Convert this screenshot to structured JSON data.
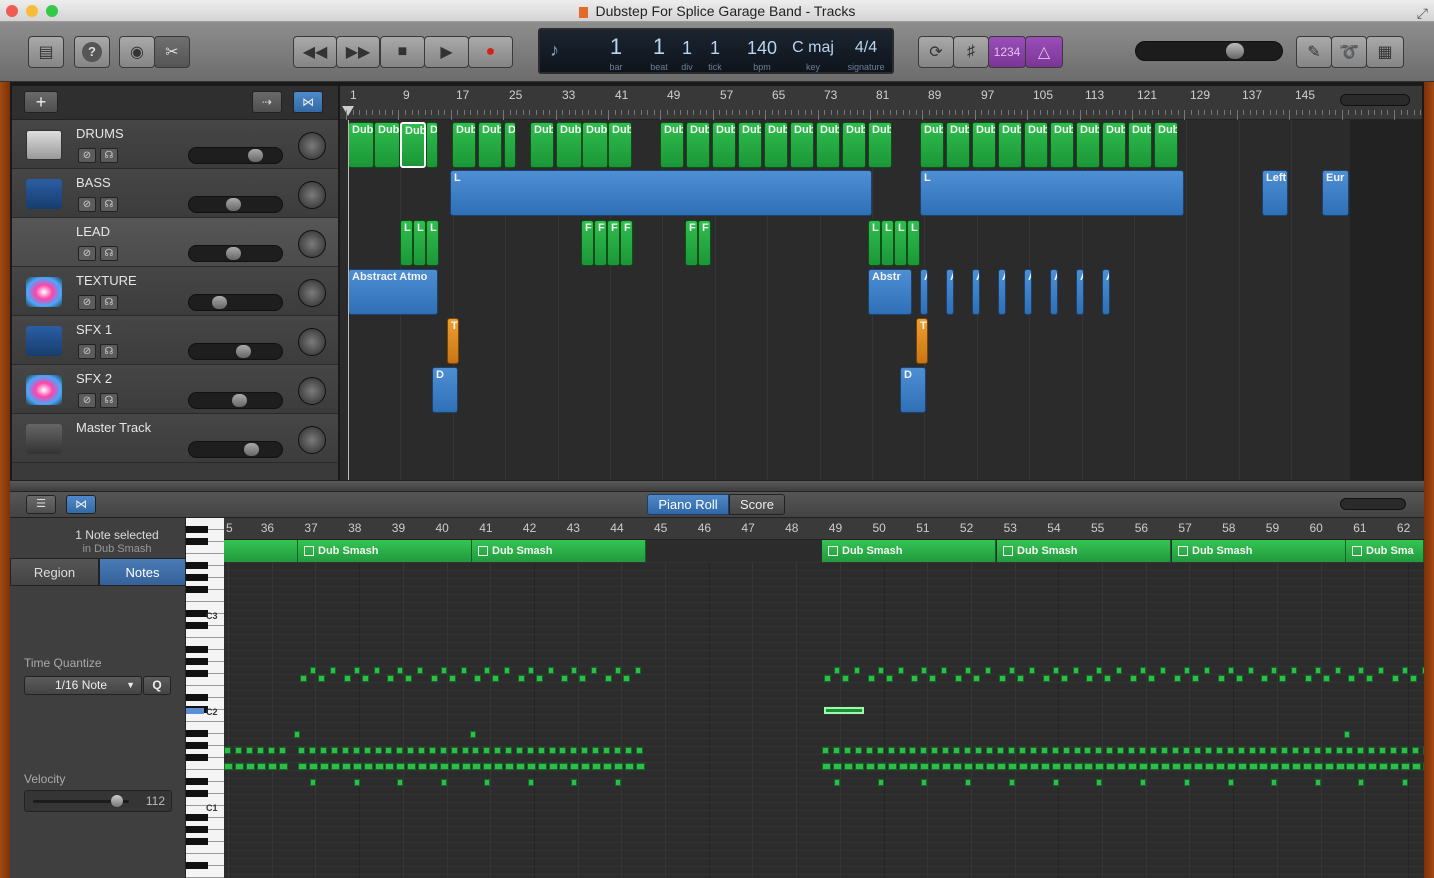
{
  "window": {
    "title": "Dubstep For Splice Garage Band - Tracks"
  },
  "toolbar": {
    "library_icon": "library-icon",
    "help_icon": "help-icon",
    "smart_controls_icon": "smart-controls-icon",
    "editors_icon": "editors-icon",
    "rewind_icon": "rewind-icon",
    "forward_icon": "fast-forward-icon",
    "stop_icon": "stop-icon",
    "play_icon": "play-icon",
    "record_icon": "record-icon",
    "cycle_icon": "cycle-icon",
    "tuner_icon": "tuner-icon",
    "count_in": "1234",
    "metronome_icon": "metronome-icon",
    "notepad_icon": "notepad-icon",
    "loops_icon": "loop-browser-icon",
    "media_icon": "media-browser-icon"
  },
  "lcd": {
    "bar_value": "1",
    "bar_label": "bar",
    "beat_value": "1",
    "beat_label": "beat",
    "div_value": "1",
    "div_label": "div",
    "tick_value": "1",
    "tick_label": "tick",
    "tempo_value": "140",
    "tempo_label": "bpm",
    "key_value": "C maj",
    "key_label": "key",
    "signature_value": "4/4",
    "signature_label": "signature"
  },
  "tracks": [
    {
      "name": "DRUMS",
      "icon": "drum-machine-icon"
    },
    {
      "name": "BASS",
      "icon": "synth-bass-icon"
    },
    {
      "name": "LEAD",
      "icon": "keyboard-stand-icon"
    },
    {
      "name": "TEXTURE",
      "icon": "sparkle-icon"
    },
    {
      "name": "SFX 1",
      "icon": "synth-bass-icon"
    },
    {
      "name": "SFX 2",
      "icon": "sparkle-icon"
    },
    {
      "name": "Master Track",
      "icon": "master-icon"
    }
  ],
  "ruler": {
    "bars": [
      "1",
      "9",
      "17",
      "25",
      "33",
      "41",
      "49",
      "57",
      "65",
      "73",
      "81",
      "89",
      "97",
      "105",
      "113",
      "121",
      "129",
      "137",
      "145"
    ]
  },
  "regions": {
    "drums": "Dub",
    "bass": "L",
    "lead": "L",
    "lead2": "F",
    "texture": "Abstract Atmo",
    "texture2": "Abstr",
    "sfx1": "T",
    "sfx2": "D",
    "bass_left": "Left",
    "bass_eur": "Eur"
  },
  "editor": {
    "tab_piano": "Piano Roll",
    "tab_score": "Score",
    "selection_info": "1 Note selected",
    "selection_region": "in Dub Smash",
    "inspector_tab_region": "Region",
    "inspector_tab_notes": "Notes",
    "time_quantize_label": "Time Quantize",
    "time_quantize_value": "1/16 Note",
    "quantize_button": "Q",
    "velocity_label": "Velocity",
    "velocity_value": "112",
    "velocity_level": 0.88,
    "key_labels": [
      "C3",
      "C2",
      "C1"
    ],
    "ruler": [
      "5",
      "36",
      "37",
      "38",
      "39",
      "40",
      "41",
      "42",
      "43",
      "44",
      "45",
      "46",
      "47",
      "48",
      "49",
      "50",
      "51",
      "52",
      "53",
      "54",
      "55",
      "56",
      "57",
      "58",
      "59",
      "60",
      "61",
      "62"
    ],
    "region_name": "Dub Smash",
    "region_name_cut": "Dub Sma"
  },
  "mixer_levels": {
    "drums": 0.75,
    "bass": 0.47,
    "lead": 0.47,
    "texture": 0.29,
    "sfx1": 0.6,
    "sfx2": 0.55,
    "master": 0.7
  }
}
